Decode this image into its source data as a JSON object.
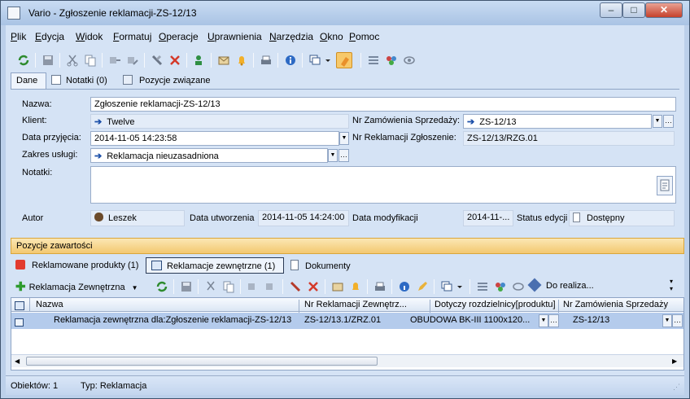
{
  "window": {
    "title": "Vario - Zgłoszenie reklamacji-ZS-12/13",
    "min_label": "–",
    "max_label": "□",
    "close_label": "✕"
  },
  "menu": [
    "Plik",
    "Edycja",
    "Widok",
    "Formatuj",
    "Operacje",
    "Uprawnienia",
    "Narzędzia",
    "Okno",
    "Pomoc"
  ],
  "top_tabs": [
    "Dane",
    "Notatki (0)",
    "Pozycje związane"
  ],
  "form": {
    "nazwa_label": "Nazwa:",
    "nazwa_value": "Zgłoszenie reklamacji-ZS-12/13",
    "klient_label": "Klient:",
    "klient_value": "Twelve",
    "nr_zam_label": "Nr Zamówienia Sprzedaży:",
    "nr_zam_value": "ZS-12/13",
    "data_przyjecia_label": "Data przyjęcia:",
    "data_przyjecia_value": "2014-11-05 14:23:58",
    "nr_reklamacji_label": "Nr Reklamacji Zgłoszenie:",
    "nr_reklamacji_value": "ZS-12/13/RZG.01",
    "zakres_label": "Zakres usługi:",
    "zakres_value": "Reklamacja nieuzasadniona",
    "notatki_label": "Notatki:",
    "autor_label": "Autor",
    "autor_value": "Leszek",
    "data_utworzenia_label": "Data utworzenia",
    "data_utworzenia_value": "2014-11-05 14:24:00",
    "data_modyfikacji_label": "Data modyfikacji",
    "data_modyfikacji_value": "2014-11-...",
    "status_label": "Status edycji",
    "status_value": "Dostępny"
  },
  "panel": {
    "header": "Pozycje zawartości",
    "tabs": [
      "Reklamowane produkty (1)",
      "Reklamacje zewnętrzne (1)",
      "Dokumenty"
    ],
    "add_button": "Reklamacja Zewnętrzna",
    "do_realiz": "Do realiza..."
  },
  "grid": {
    "columns": [
      "Nazwa",
      "Nr Reklamacji Zewnętrz...",
      "Dotyczy rozdzielnicy[produktu]",
      "Nr Zamówienia Sprzedaży"
    ],
    "row": [
      "Reklamacja zewnętrzna dla:Zgłoszenie reklamacji-ZS-12/13",
      "ZS-12/13.1/ZRZ.01",
      "OBUDOWA  BK-III 1100x120...",
      "ZS-12/13"
    ]
  },
  "status": {
    "objects": "Obiektów: 1",
    "type": "Typ: Reklamacja"
  },
  "colors": {
    "accent": "#f3c870",
    "selection": "#b4cbec",
    "background": "#d5e3f5"
  }
}
